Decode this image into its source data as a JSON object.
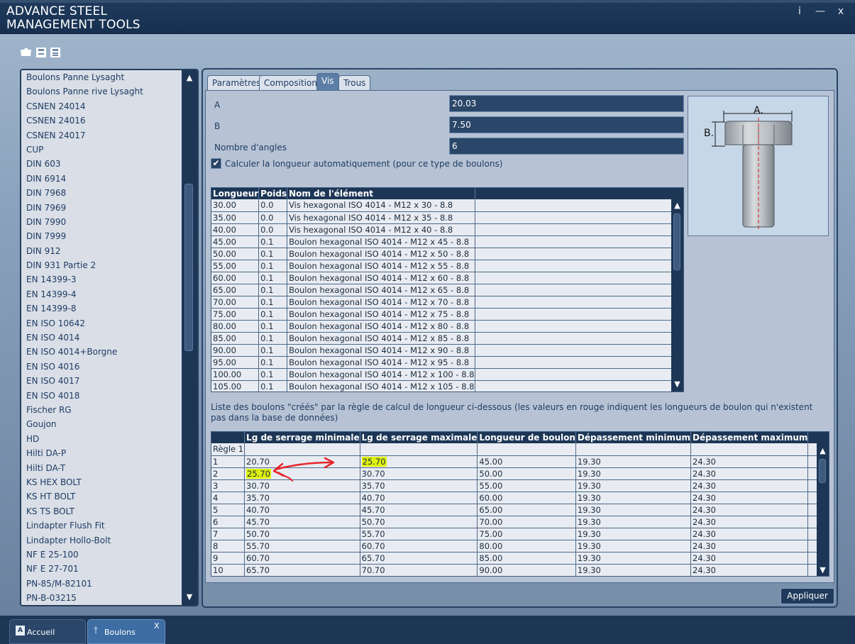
{
  "app": {
    "title_line1": "ADVANCE STEEL",
    "title_line2": "MANAGEMENT TOOLS",
    "info_label": "i",
    "minimize_label": "—",
    "close_label": "x"
  },
  "toolbar": {
    "icons": [
      "open-folder-icon",
      "save-icon",
      "save-as-icon"
    ]
  },
  "left_list": {
    "items": [
      "Boulons Panne Lysaght",
      "Boulons Panne rive Lysaght",
      "CSNEN 24014",
      "CSNEN 24016",
      "CSNEN 24017",
      "CUP",
      "DIN 603",
      "DIN 6914",
      "DIN 7968",
      "DIN 7969",
      "DIN 7990",
      "DIN 7999",
      "DIN 912",
      "DIN 931 Partie 2",
      "EN 14399-3",
      "EN 14399-4",
      "EN 14399-8",
      "EN ISO 10642",
      "EN ISO 4014",
      "EN ISO 4014+Borgne",
      "EN ISO 4016",
      "EN ISO 4017",
      "EN ISO 4018",
      "Fischer RG",
      "Goujon",
      "HD",
      "Hilti DA-P",
      "Hilti DA-T",
      "KS HEX BOLT",
      "KS HT BOLT",
      "KS TS BOLT",
      "Lindapter Flush Fit",
      "Lindapter Hollo-Bolt",
      "NF E 25-100",
      "NF E 27-701",
      "PN-85/M-82101",
      "PN-B-03215"
    ]
  },
  "tabs": [
    {
      "label": "Paramètres",
      "active": false
    },
    {
      "label": "Composition",
      "active": false
    },
    {
      "label": "Vis",
      "active": true
    },
    {
      "label": "Trous",
      "active": false
    }
  ],
  "fields": {
    "a_label": "A",
    "a_value": "20.03",
    "b_label": "B",
    "b_value": "7.50",
    "angles_label": "Nombre d'angles",
    "angles_value": "6"
  },
  "checkbox": {
    "label": "Calculer la longueur automatiquement (pour ce type de boulons)",
    "checked": true
  },
  "diagram": {
    "label_a": "A.",
    "label_b": "B."
  },
  "elements_table": {
    "headers": [
      "Longueur",
      "Poids",
      "Nom de l'élément"
    ],
    "rows": [
      [
        "30.00",
        "0.0",
        "Vis hexagonal ISO 4014 - M12 x 30 - 8.8"
      ],
      [
        "35.00",
        "0.0",
        "Vis hexagonal ISO 4014 - M12 x 35 - 8.8"
      ],
      [
        "40.00",
        "0.0",
        "Vis hexagonal ISO 4014 - M12 x 40 - 8.8"
      ],
      [
        "45.00",
        "0.1",
        "Boulon hexagonal ISO 4014 - M12 x 45 - 8.8"
      ],
      [
        "50.00",
        "0.1",
        "Boulon hexagonal ISO 4014 - M12 x 50 - 8.8"
      ],
      [
        "55.00",
        "0.1",
        "Boulon hexagonal ISO 4014 - M12 x 55 - 8.8"
      ],
      [
        "60.00",
        "0.1",
        "Boulon hexagonal ISO 4014 - M12 x 60 - 8.8"
      ],
      [
        "65.00",
        "0.1",
        "Boulon hexagonal ISO 4014 - M12 x 65 - 8.8"
      ],
      [
        "70.00",
        "0.1",
        "Boulon hexagonal ISO 4014 - M12 x 70 - 8.8"
      ],
      [
        "75.00",
        "0.1",
        "Boulon hexagonal ISO 4014 - M12 x 75 - 8.8"
      ],
      [
        "80.00",
        "0.1",
        "Boulon hexagonal ISO 4014 - M12 x 80 - 8.8"
      ],
      [
        "85.00",
        "0.1",
        "Boulon hexagonal ISO 4014 - M12 x 85 - 8.8"
      ],
      [
        "90.00",
        "0.1",
        "Boulon hexagonal ISO 4014 - M12 x 90 - 8.8"
      ],
      [
        "95.00",
        "0.1",
        "Boulon hexagonal ISO 4014 - M12 x 95 - 8.8"
      ],
      [
        "100.00",
        "0.1",
        "Boulon hexagonal ISO 4014 - M12 x 100 - 8.8"
      ],
      [
        "105.00",
        "0.1",
        "Boulon hexagonal ISO 4014 - M12 x 105 - 8.8"
      ]
    ]
  },
  "list_note": "Liste des boulons \"créés\" par la règle de calcul de longueur ci-dessous (les valeurs en rouge indiquent les longueurs de boulon qui n'existent pas dans la base de données)",
  "rules_table": {
    "headers": [
      "",
      "Lg de serrage minimale",
      "Lg de serrage maximale",
      "Longueur de boulon",
      "Dépassement minimum",
      "Dépassement maximum",
      ""
    ],
    "group_label": "Règle 1",
    "rows": [
      [
        "1",
        "20.70",
        "25.70",
        "45.00",
        "19.30",
        "24.30"
      ],
      [
        "2",
        "25.70",
        "30.70",
        "50.00",
        "19.30",
        "24.30"
      ],
      [
        "3",
        "30.70",
        "35.70",
        "55.00",
        "19.30",
        "24.30"
      ],
      [
        "4",
        "35.70",
        "40.70",
        "60.00",
        "19.30",
        "24.30"
      ],
      [
        "5",
        "40.70",
        "45.70",
        "65.00",
        "19.30",
        "24.30"
      ],
      [
        "6",
        "45.70",
        "50.70",
        "70.00",
        "19.30",
        "24.30"
      ],
      [
        "7",
        "50.70",
        "55.70",
        "75.00",
        "19.30",
        "24.30"
      ],
      [
        "8",
        "55.70",
        "60.70",
        "80.00",
        "19.30",
        "24.30"
      ],
      [
        "9",
        "60.70",
        "65.70",
        "85.00",
        "19.30",
        "24.30"
      ],
      [
        "10",
        "65.70",
        "70.70",
        "90.00",
        "19.30",
        "24.30"
      ]
    ],
    "highlight_color": "#dff20a",
    "arrow_color": "#e8252a"
  },
  "apply_label": "Appliquer",
  "bottom_tabs": [
    {
      "label": "Accueil",
      "icon": "advance-steel-app-icon"
    },
    {
      "label": "Boulons",
      "icon": "bolt-icon",
      "close": "X"
    }
  ]
}
